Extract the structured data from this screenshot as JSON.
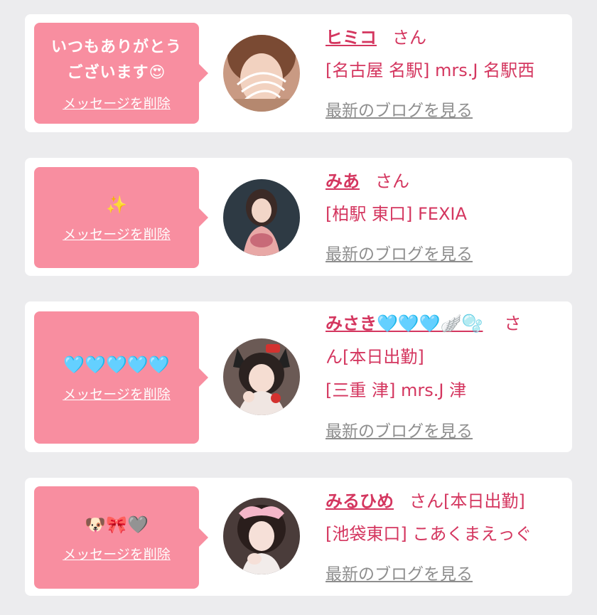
{
  "honorific": "さん",
  "blog_link": "最新のブログを見る",
  "delete_label": "メッセージを削除",
  "cards": [
    {
      "message_line1": "いつもありがとう",
      "message_line2": "ございます😍",
      "name": "ヒミコ",
      "shop": "[名古屋 名駅] mrs.J 名駅西"
    },
    {
      "message_emoji": "✨",
      "name": "みあ",
      "shop": "[柏駅 東口] FEXIA"
    },
    {
      "message_emoji": "🩵🩵🩵🩵🩵",
      "name": "みさき🩵🩵🩵🪽🫧",
      "name_suffix_line2": "ん[本日出勤]",
      "name_suffix_line1": "さ",
      "shop": "[三重 津] mrs.J 津"
    },
    {
      "message_emoji": "🐶🎀🩶",
      "name": "みるひめ",
      "status": "[本日出勤]",
      "shop": "[池袋東口] こあくまえっぐ"
    }
  ],
  "colors": {
    "background": "#ececee",
    "bubble": "#f88ea0",
    "accent_text": "#d4365f",
    "link_gray": "#8e8e8e"
  }
}
